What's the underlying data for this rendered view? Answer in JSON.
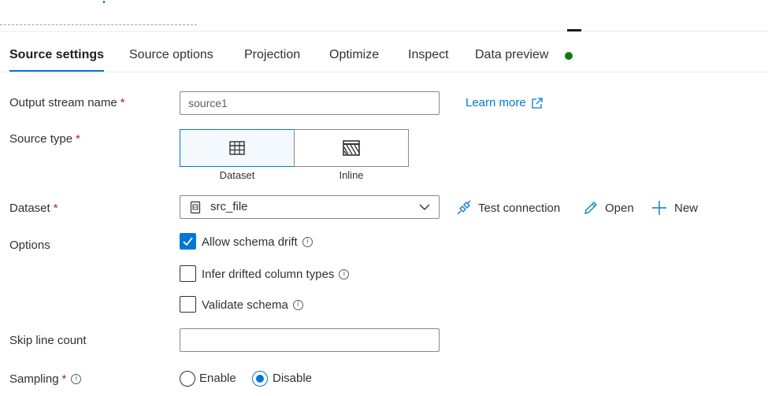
{
  "tabs": [
    {
      "label": "Source settings",
      "active": true
    },
    {
      "label": "Source options"
    },
    {
      "label": "Projection"
    },
    {
      "label": "Optimize"
    },
    {
      "label": "Inspect"
    },
    {
      "label": "Data preview",
      "status_color": "#107c10"
    }
  ],
  "form": {
    "output_stream": {
      "label": "Output stream name",
      "required": "*",
      "value": "source1"
    },
    "learn_more": "Learn more",
    "source_type": {
      "label": "Source type",
      "required": "*",
      "options": [
        {
          "label": "Dataset",
          "icon": "table-icon",
          "selected": true
        },
        {
          "label": "Inline",
          "icon": "inline-hatch-icon",
          "selected": false
        }
      ]
    },
    "dataset": {
      "label": "Dataset",
      "required": "*",
      "value": "src_file"
    },
    "actions": {
      "test_connection": "Test connection",
      "open": "Open",
      "new": "New"
    },
    "options": {
      "label": "Options",
      "items": [
        {
          "label": "Allow schema drift",
          "checked": true
        },
        {
          "label": "Infer drifted column types",
          "checked": false
        },
        {
          "label": "Validate schema",
          "checked": false
        }
      ]
    },
    "skip_line_count": {
      "label": "Skip line count",
      "value": ""
    },
    "sampling": {
      "label": "Sampling",
      "required": "*",
      "options": [
        {
          "label": "Enable",
          "selected": false
        },
        {
          "label": "Disable",
          "selected": true
        }
      ]
    }
  },
  "colors": {
    "accent": "#0078d4",
    "required": "#a4262c",
    "status_ok": "#107c10"
  }
}
